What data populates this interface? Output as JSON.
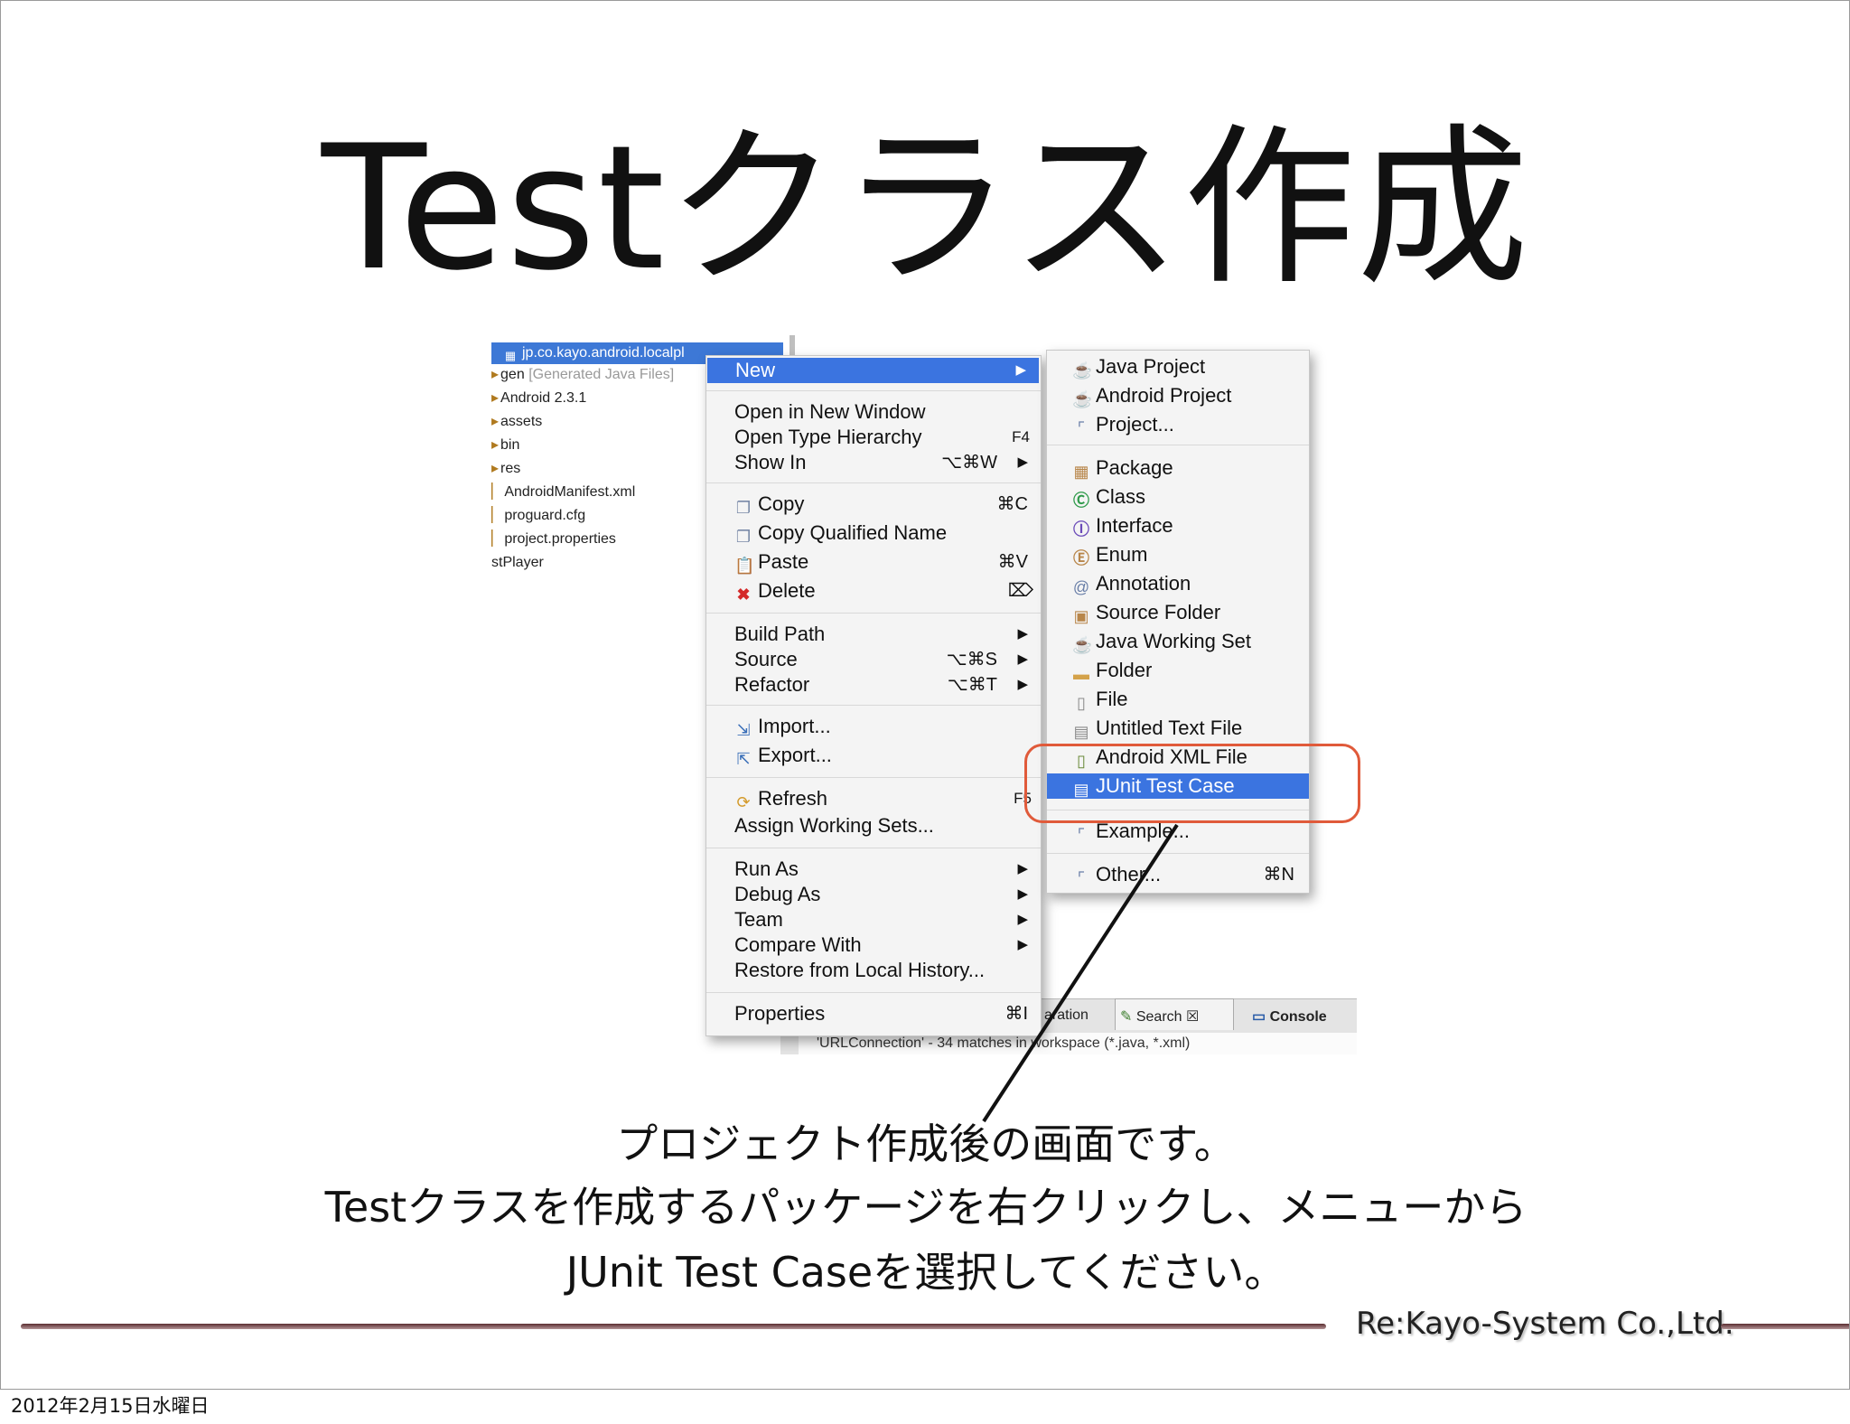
{
  "slide": {
    "title": "Testクラス作成",
    "caption_lines": [
      "プロジェクト作成後の画面です。",
      "Testクラスを作成するパッケージを右クリックし、メニューから",
      "JUnit Test Caseを選択してください。"
    ],
    "company": "Re:Kayo-System Co.,Ltd.",
    "date": "2012年2月15日水曜日",
    "highlight_color": "#e05a3a"
  },
  "package_explorer": {
    "root": "jp.co.kayo.android.localpl",
    "items": [
      {
        "name": "gen",
        "note": "[Generated Java Files]"
      },
      {
        "name": "Android 2.3.1",
        "note": ""
      },
      {
        "name": "assets",
        "note": ""
      },
      {
        "name": "bin",
        "note": ""
      },
      {
        "name": "res",
        "note": ""
      },
      {
        "name": "AndroidManifest.xml",
        "note": ""
      },
      {
        "name": "proguard.cfg",
        "note": ""
      },
      {
        "name": "project.properties",
        "note": ""
      },
      {
        "name": "stPlayer",
        "note": ""
      }
    ]
  },
  "views": {
    "tab_declaration": "aration",
    "tab_search": "Search",
    "tab_search_close": "☒",
    "tab_console": "Console",
    "search_result": "'URLConnection' - 34 matches in workspace (*.java, *.xml)"
  },
  "context_menu": {
    "new": "New",
    "open_in_new_window": "Open in New Window",
    "open_type_hierarchy": "Open Type Hierarchy",
    "open_type_hierarchy_sc": "F4",
    "show_in": "Show In",
    "show_in_sc": "⌥⌘W",
    "copy": "Copy",
    "copy_sc": "⌘C",
    "copy_qualified_name": "Copy Qualified Name",
    "paste": "Paste",
    "paste_sc": "⌘V",
    "delete": "Delete",
    "delete_sc": "⌦",
    "build_path": "Build Path",
    "source": "Source",
    "source_sc": "⌥⌘S",
    "refactor": "Refactor",
    "refactor_sc": "⌥⌘T",
    "import": "Import...",
    "export": "Export...",
    "refresh": "Refresh",
    "refresh_sc": "F5",
    "assign_working_sets": "Assign Working Sets...",
    "run_as": "Run As",
    "debug_as": "Debug As",
    "team": "Team",
    "compare_with": "Compare With",
    "restore_local_history": "Restore from Local History...",
    "properties": "Properties",
    "properties_sc": "⌘I"
  },
  "new_submenu": {
    "java_project": "Java Project",
    "android_project": "Android Project",
    "project": "Project...",
    "package": "Package",
    "class": "Class",
    "interface": "Interface",
    "enum": "Enum",
    "annotation": "Annotation",
    "source_folder": "Source Folder",
    "java_working_set": "Java Working Set",
    "folder": "Folder",
    "file": "File",
    "untitled_text_file": "Untitled Text File",
    "android_xml_file": "Android XML File",
    "junit_test_case": "JUnit Test Case",
    "example": "Example...",
    "other": "Other...",
    "other_sc": "⌘N"
  }
}
